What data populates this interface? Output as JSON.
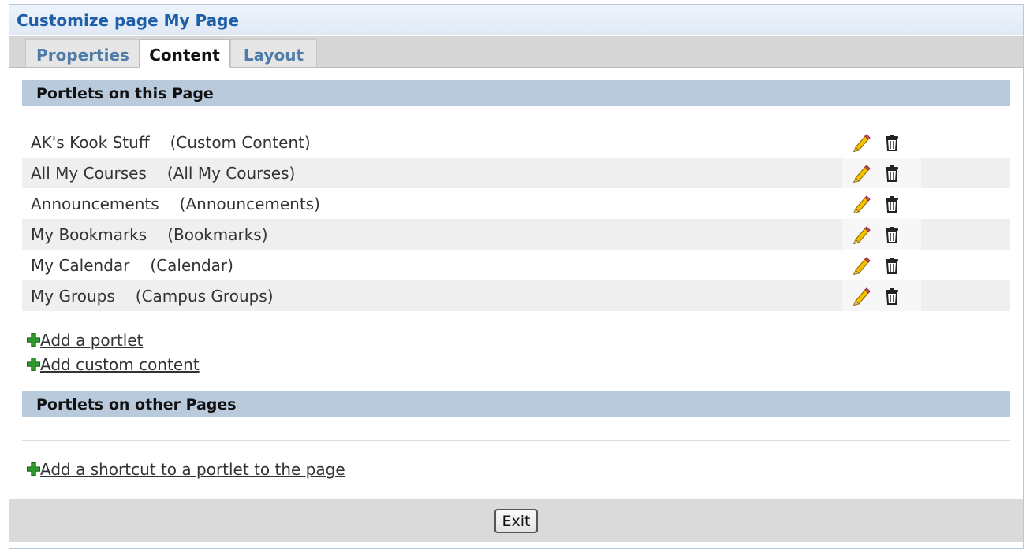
{
  "title": "Customize page My Page",
  "tabs": [
    {
      "label": "Properties"
    },
    {
      "label": "Content"
    },
    {
      "label": "Layout"
    }
  ],
  "active_tab": "Content",
  "sections": {
    "this_page": {
      "heading": "Portlets on this Page"
    },
    "other_pages": {
      "heading": "Portlets on other Pages"
    }
  },
  "portlets": [
    {
      "name": "AK's Kook Stuff",
      "type": "(Custom Content)"
    },
    {
      "name": "All My Courses",
      "type": "(All My Courses)"
    },
    {
      "name": "Announcements",
      "type": "(Announcements)"
    },
    {
      "name": "My Bookmarks",
      "type": "(Bookmarks)"
    },
    {
      "name": "My Calendar",
      "type": "(Calendar)"
    },
    {
      "name": "My Groups",
      "type": "(Campus Groups)"
    }
  ],
  "links": {
    "add_portlet": "Add a portlet",
    "add_custom_content": "Add custom content",
    "add_shortcut": "Add a shortcut to a portlet to the page"
  },
  "buttons": {
    "exit": "Exit"
  },
  "icons": {
    "edit": "pencil-icon",
    "delete": "trash-icon",
    "add": "plus-icon"
  },
  "colors": {
    "title": "#1e5fa8",
    "section_header_bg": "#b9cadd",
    "tab_inactive_text": "#4f7ba8",
    "add_icon": "#2e9a2e"
  }
}
